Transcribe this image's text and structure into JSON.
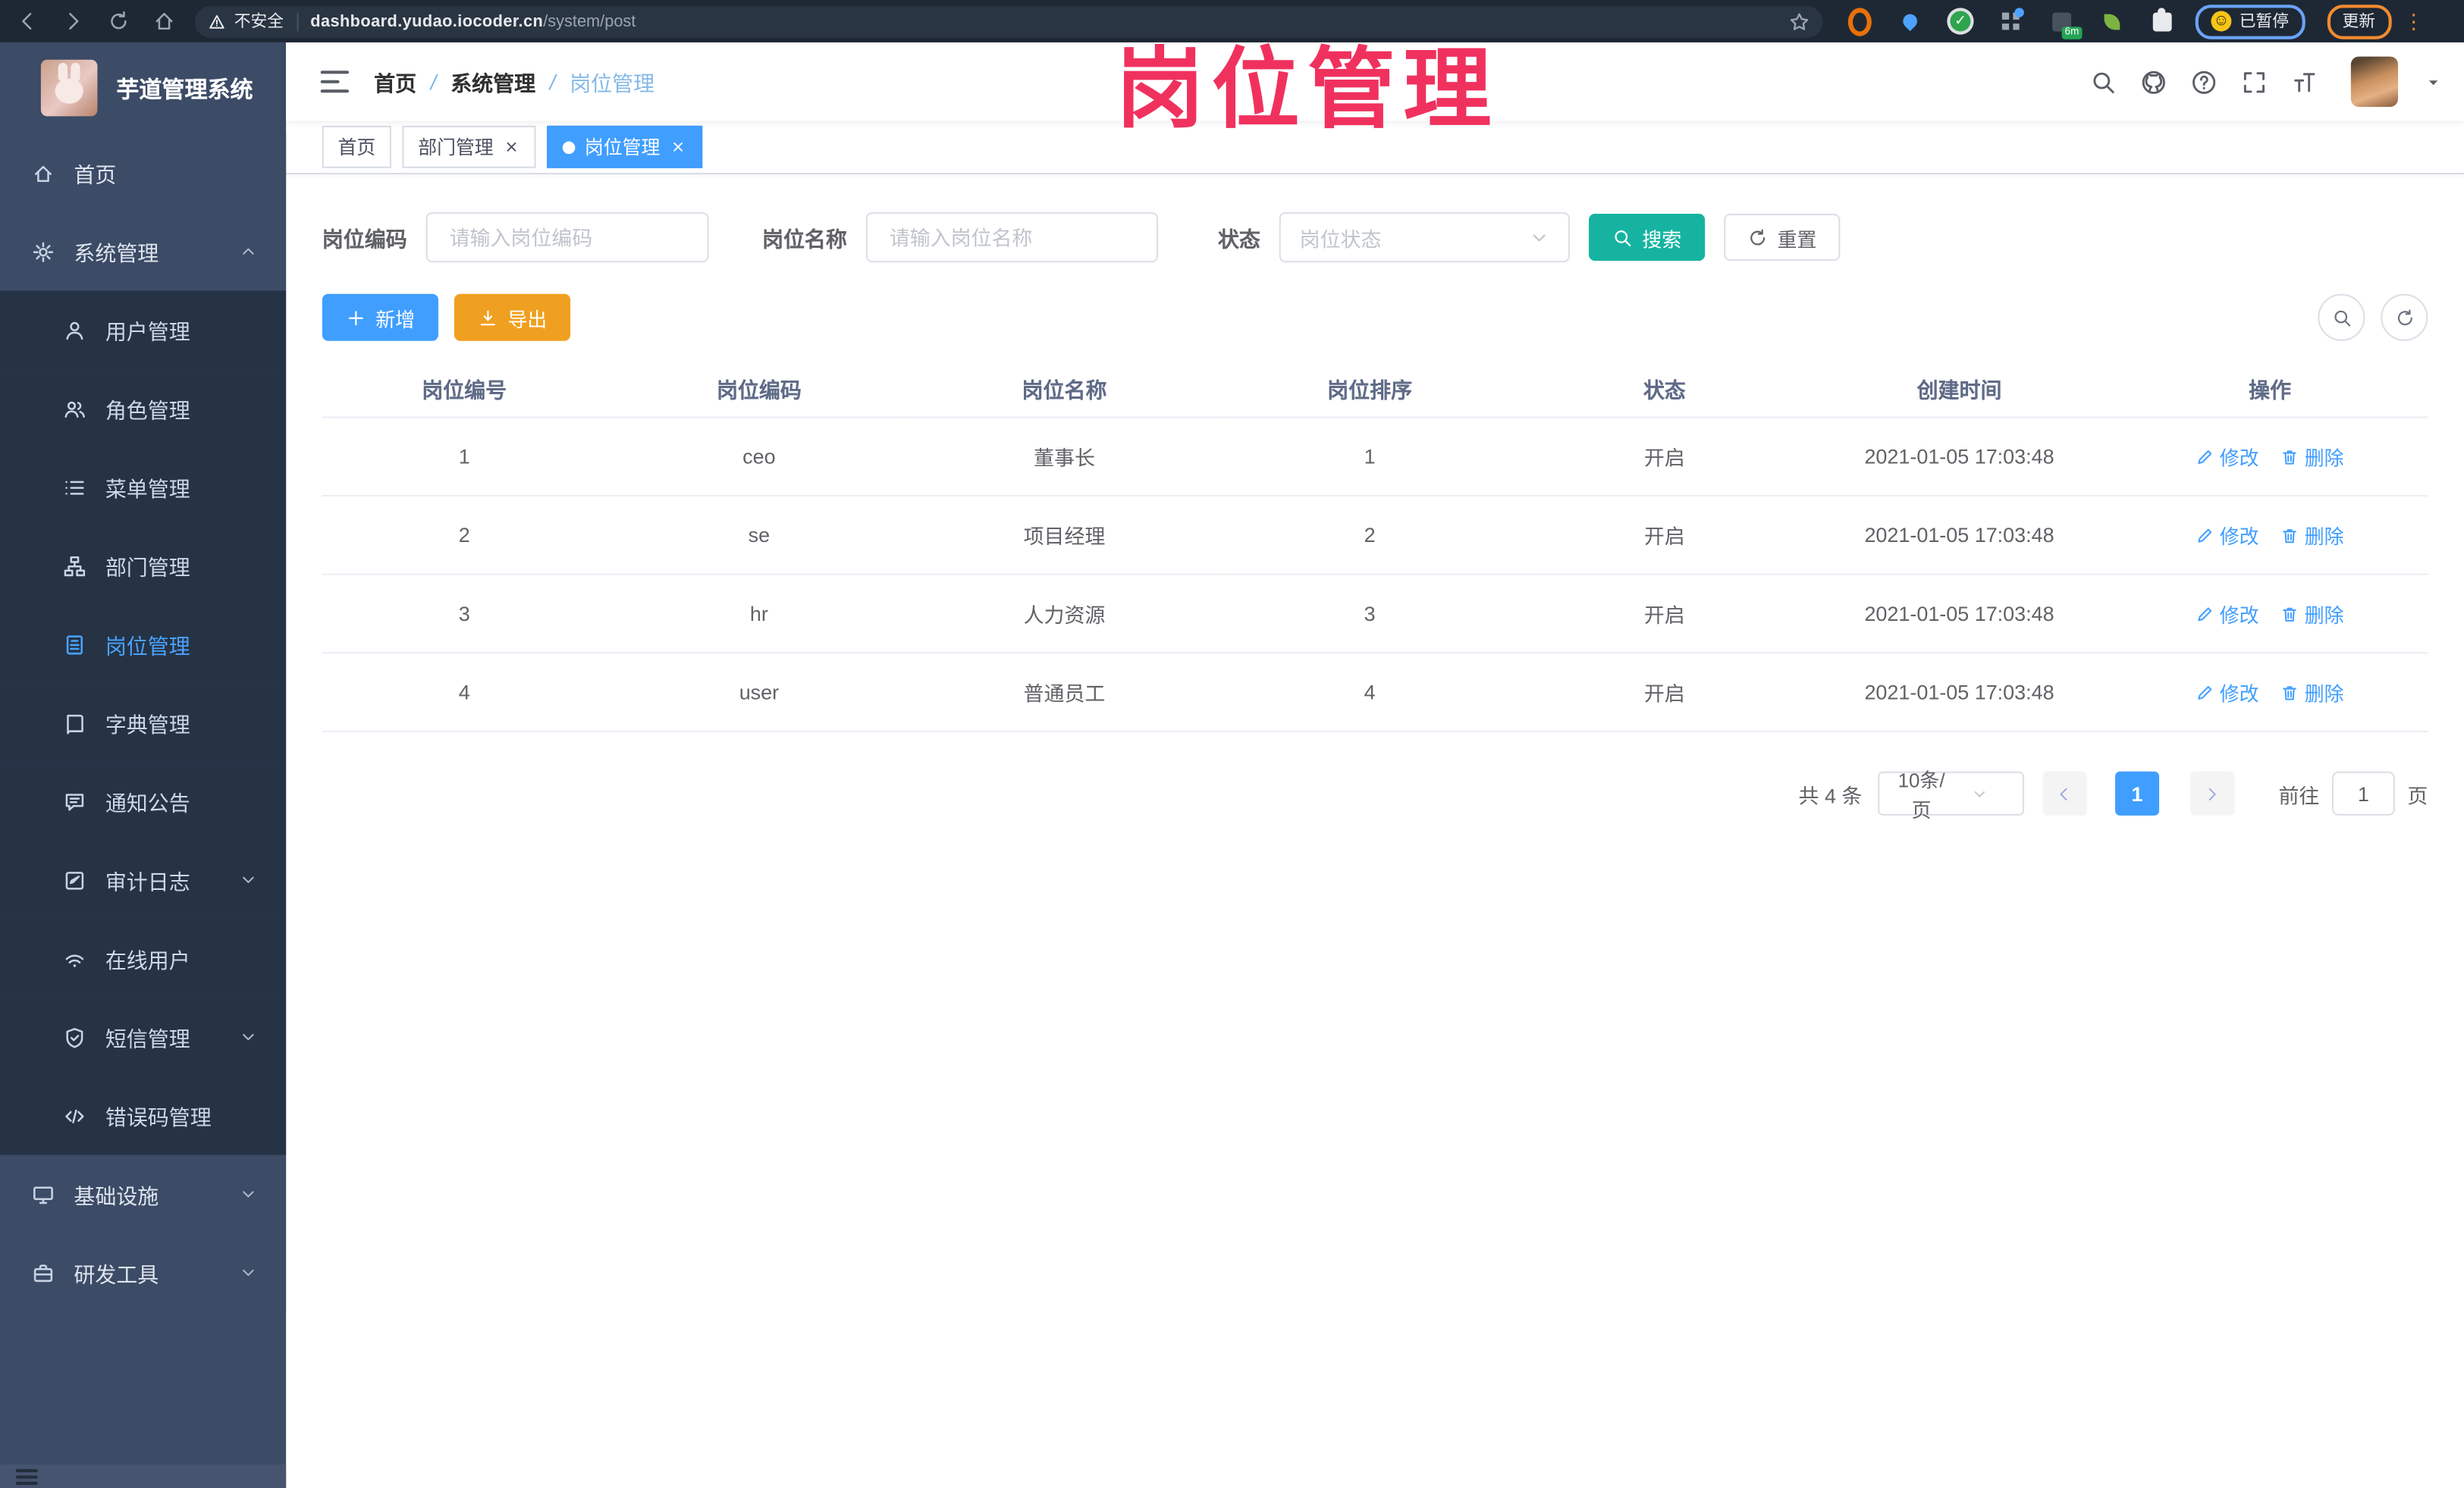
{
  "overlay_title": "岗位管理",
  "browser": {
    "security_label": "不安全",
    "url_host": "dashboard.yudao.iocoder.cn",
    "url_path": "/system/post",
    "paused_label": "已暂停",
    "update_label": "更新",
    "extensions": [
      {
        "key": "orange-ring-extension",
        "shape": "ring"
      },
      {
        "key": "location-pin-extension",
        "shape": "pin"
      },
      {
        "key": "green-check-extension",
        "shape": "check",
        "glyph": "✓"
      },
      {
        "key": "grid-blue-dot-extension",
        "shape": "grid"
      },
      {
        "key": "terminal-extension",
        "shape": "square",
        "badge": "6m"
      },
      {
        "key": "sprout-extension",
        "shape": "sprout"
      },
      {
        "key": "puzzle-extensions-menu",
        "shape": "puzzle"
      }
    ]
  },
  "sidebar": {
    "logo_title": "芋道管理系统",
    "items": [
      {
        "key": "home",
        "label": "首页",
        "icon": "home",
        "depth": 0
      },
      {
        "key": "system",
        "label": "系统管理",
        "icon": "gear",
        "depth": 0,
        "arrow": "up"
      },
      {
        "key": "users",
        "label": "用户管理",
        "icon": "user",
        "depth": 1
      },
      {
        "key": "roles",
        "label": "角色管理",
        "icon": "users",
        "depth": 1
      },
      {
        "key": "menus",
        "label": "菜单管理",
        "icon": "list",
        "depth": 1
      },
      {
        "key": "departments",
        "label": "部门管理",
        "icon": "tree",
        "depth": 1
      },
      {
        "key": "posts",
        "label": "岗位管理",
        "icon": "badge",
        "depth": 1,
        "active": true
      },
      {
        "key": "dictionary",
        "label": "字典管理",
        "icon": "book",
        "depth": 1
      },
      {
        "key": "notice",
        "label": "通知公告",
        "icon": "bubble",
        "depth": 1
      },
      {
        "key": "audit-log",
        "label": "审计日志",
        "icon": "audit",
        "depth": 1,
        "arrow": "down"
      },
      {
        "key": "online-users",
        "label": "在线用户",
        "icon": "online",
        "depth": 1
      },
      {
        "key": "sms",
        "label": "短信管理",
        "icon": "shield",
        "depth": 1,
        "arrow": "down"
      },
      {
        "key": "error-codes",
        "label": "错误码管理",
        "icon": "code",
        "depth": 1
      },
      {
        "key": "infrastructure",
        "label": "基础设施",
        "icon": "monitor",
        "depth": 0,
        "arrow": "down"
      },
      {
        "key": "dev-tools",
        "label": "研发工具",
        "icon": "toolbox",
        "depth": 0,
        "arrow": "down"
      }
    ]
  },
  "header": {
    "breadcrumb": [
      "首页",
      "系统管理",
      "岗位管理"
    ]
  },
  "tabs": [
    {
      "label": "首页",
      "closable": false,
      "active": false
    },
    {
      "label": "部门管理",
      "closable": true,
      "active": false
    },
    {
      "label": "岗位管理",
      "closable": true,
      "active": true
    }
  ],
  "filters": {
    "code_label": "岗位编码",
    "code_placeholder": "请输入岗位编码",
    "name_label": "岗位名称",
    "name_placeholder": "请输入岗位名称",
    "status_label": "状态",
    "status_placeholder": "岗位状态",
    "search_label": "搜索",
    "reset_label": "重置"
  },
  "toolbar": {
    "add_label": "新增",
    "export_label": "导出"
  },
  "table": {
    "columns": [
      "岗位编号",
      "岗位编码",
      "岗位名称",
      "岗位排序",
      "状态",
      "创建时间",
      "操作"
    ],
    "rows": [
      {
        "id": "1",
        "code": "ceo",
        "name": "董事长",
        "sort": "1",
        "status": "开启",
        "created": "2021-01-05 17:03:48"
      },
      {
        "id": "2",
        "code": "se",
        "name": "项目经理",
        "sort": "2",
        "status": "开启",
        "created": "2021-01-05 17:03:48"
      },
      {
        "id": "3",
        "code": "hr",
        "name": "人力资源",
        "sort": "3",
        "status": "开启",
        "created": "2021-01-05 17:03:48"
      },
      {
        "id": "4",
        "code": "user",
        "name": "普通员工",
        "sort": "4",
        "status": "开启",
        "created": "2021-01-05 17:03:48"
      }
    ],
    "edit_label": "修改",
    "delete_label": "删除"
  },
  "pagination": {
    "total_text": "共 4 条",
    "page_size": "10条/页",
    "current_page": "1",
    "goto_label": "前往",
    "goto_value": "1",
    "page_unit": "页"
  },
  "colors": {
    "primary": "#409EFF",
    "search_teal": "#16B4A0",
    "export_orange": "#F0A020",
    "overlay_pink": "#F0315E",
    "sidebar_bg": "#3C4B66",
    "sidebar_submenu_bg": "#263345"
  }
}
